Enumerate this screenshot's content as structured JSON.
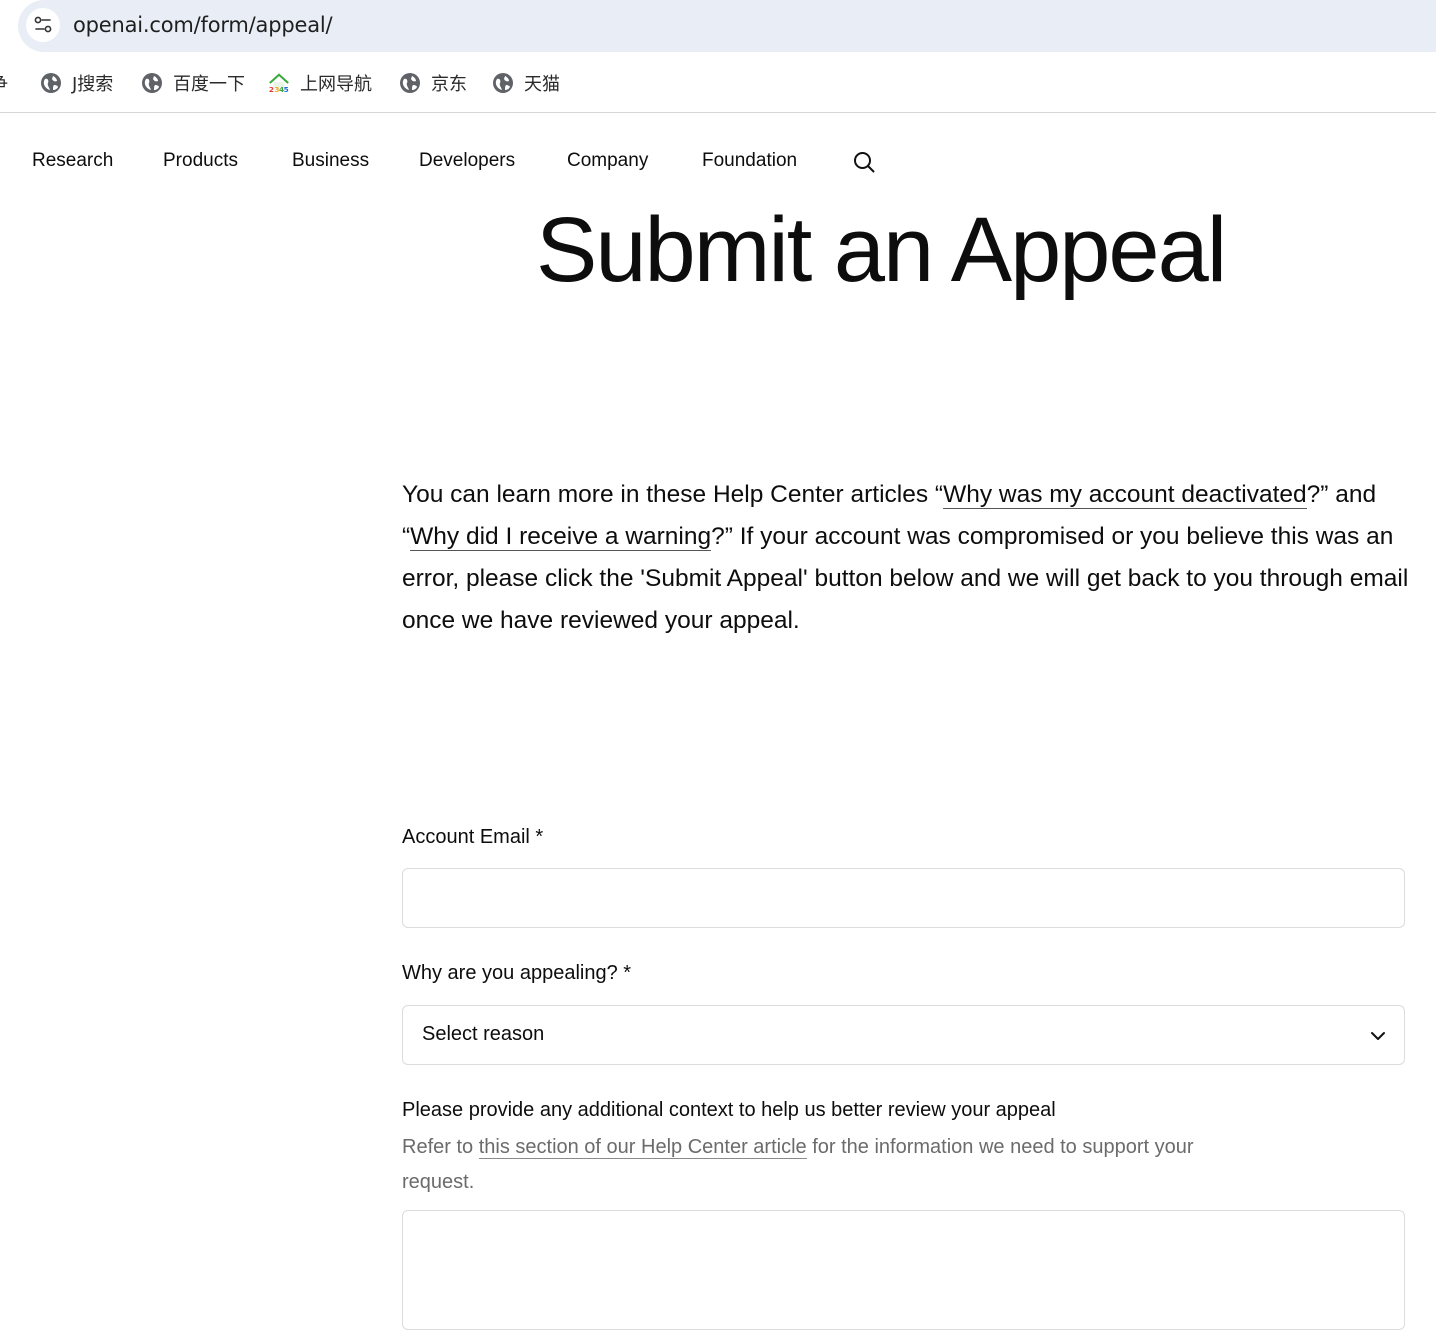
{
  "browser": {
    "url": "openai.com/form/appeal/",
    "bookmarks": [
      {
        "label": "争",
        "icon": "cut-off-bookmark"
      },
      {
        "label": "J搜索",
        "icon": "globe-icon"
      },
      {
        "label": "百度一下",
        "icon": "globe-icon"
      },
      {
        "label": "上网导航",
        "icon": "2345-house-icon"
      },
      {
        "label": "京东",
        "icon": "globe-icon"
      },
      {
        "label": "天猫",
        "icon": "globe-icon"
      }
    ]
  },
  "nav": {
    "items": [
      "Research",
      "Products",
      "Business",
      "Developers",
      "Company",
      "Foundation"
    ],
    "search_icon": "search-icon"
  },
  "page": {
    "title": "Submit an Appeal",
    "intro": {
      "p1": "You can learn more in these Help Center articles “",
      "link1": "Why was my account deactivated",
      "p2": "?” and “",
      "link2": "Why did I receive a warning",
      "p3": "?” If your account was compromised or you believe this was an error, please click the 'Submit Appeal' button below and we will get back to you through email once we have reviewed your appeal."
    }
  },
  "form": {
    "email_label": "Account Email *",
    "email_value": "",
    "reason_label": "Why are you appealing? *",
    "reason_selected": "Select reason",
    "context_label": "Please provide any additional context to help us better review your appeal",
    "context_help": {
      "prefix": "Refer to ",
      "link": "this section of our Help Center article",
      "suffix": " for the information we need to support your request."
    }
  },
  "colors": {
    "address_bar_bg": "#e9eef6",
    "text": "#0d0d0d",
    "muted_text": "#6b6b6b",
    "input_border": "#dcdcdc"
  }
}
